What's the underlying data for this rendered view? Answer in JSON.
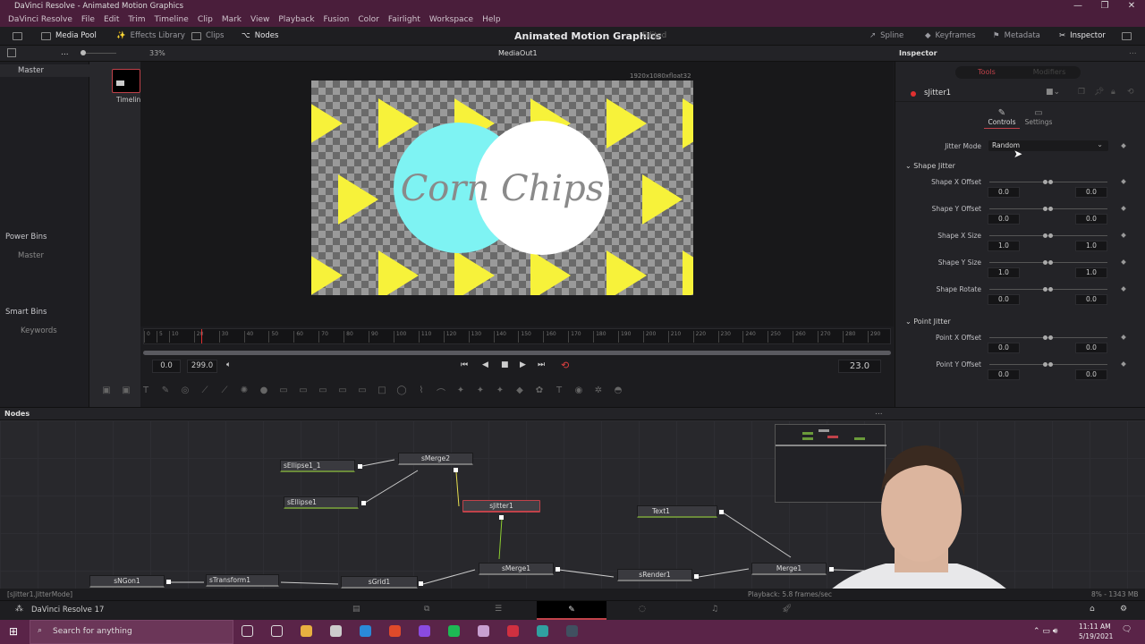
{
  "window": {
    "title": "DaVinci Resolve - Animated Motion Graphics",
    "controls": [
      "—",
      "❐",
      "✕"
    ]
  },
  "menu": [
    "DaVinci Resolve",
    "File",
    "Edit",
    "Trim",
    "Timeline",
    "Clip",
    "Mark",
    "View",
    "Playback",
    "Fusion",
    "Color",
    "Fairlight",
    "Workspace",
    "Help"
  ],
  "toolbar": {
    "media_pool": "Media Pool",
    "effects_library": "Effects Library",
    "clips": "Clips",
    "nodes": "Nodes",
    "project_title": "Animated Motion Graphics",
    "project_status": "Edited",
    "spline": "Spline",
    "keyframes": "Keyframes",
    "metadata": "Metadata",
    "inspector": "Inspector"
  },
  "viewer_bar": {
    "zoom": "33%",
    "viewer_name": "MediaOut1",
    "inspector_title": "Inspector",
    "more": "..."
  },
  "media_pool": {
    "master": "Master",
    "clip_name": "Timelin",
    "power_bins": "Power Bins",
    "power_master": "Master",
    "smart_bins": "Smart Bins",
    "keywords": "Keywords"
  },
  "viewer": {
    "resolution": "1920x1080xfloat32",
    "text": "Corn Chips",
    "colors": {
      "triangle": "#f7f23a",
      "circle_left": "#7ef3f3",
      "circle_right": "#ffffff"
    }
  },
  "timeline": {
    "ticks": [
      "0",
      "5",
      "10",
      "20",
      "30",
      "40",
      "50",
      "60",
      "70",
      "80",
      "90",
      "100",
      "110",
      "120",
      "130",
      "140",
      "150",
      "160",
      "170",
      "180",
      "190",
      "200",
      "210",
      "220",
      "230",
      "240",
      "250",
      "260",
      "270",
      "280",
      "290"
    ],
    "playhead": 23,
    "start": "0.0",
    "end": "299.0",
    "current": "23.0"
  },
  "inspector": {
    "tabs": [
      "Tools",
      "Modifiers"
    ],
    "active_tab": "Tools",
    "tool_name": "sJitter1",
    "subtabs": [
      "Controls",
      "Settings"
    ],
    "active_subtab": "Controls",
    "jitter_mode_label": "Jitter Mode",
    "jitter_mode_value": "Random",
    "groups": [
      {
        "title": "Shape Jitter",
        "params": [
          {
            "label": "Shape X Offset",
            "low": "0.0",
            "high": "0.0"
          },
          {
            "label": "Shape Y Offset",
            "low": "0.0",
            "high": "0.0"
          },
          {
            "label": "Shape X Size",
            "low": "1.0",
            "high": "1.0"
          },
          {
            "label": "Shape Y Size",
            "low": "1.0",
            "high": "1.0"
          },
          {
            "label": "Shape Rotate",
            "low": "0.0",
            "high": "0.0"
          }
        ]
      },
      {
        "title": "Point Jitter",
        "params": [
          {
            "label": "Point X Offset",
            "low": "0.0",
            "high": "0.0"
          },
          {
            "label": "Point Y Offset",
            "low": "0.0",
            "high": "0.0"
          }
        ]
      }
    ]
  },
  "nodes_panel": {
    "title": "Nodes",
    "more": "...",
    "nodes": [
      "sEllipse1_1",
      "sMerge2",
      "sEllipse1",
      "sJitter1",
      "Text1",
      "sNGon1",
      "sTransform1",
      "sGrid1",
      "sMerge1",
      "sRender1",
      "Merge1"
    ]
  },
  "status": {
    "left": "[sJitter1.JitterMode]",
    "playback": "Playback: 5.8 frames/sec",
    "memory": "8% - 1343 MB"
  },
  "pagebar": {
    "app": "DaVinci Resolve 17",
    "active_page": "Fusion"
  },
  "taskbar": {
    "search_placeholder": "Search for anything",
    "time": "11:11 AM",
    "date": "5/19/2021"
  }
}
